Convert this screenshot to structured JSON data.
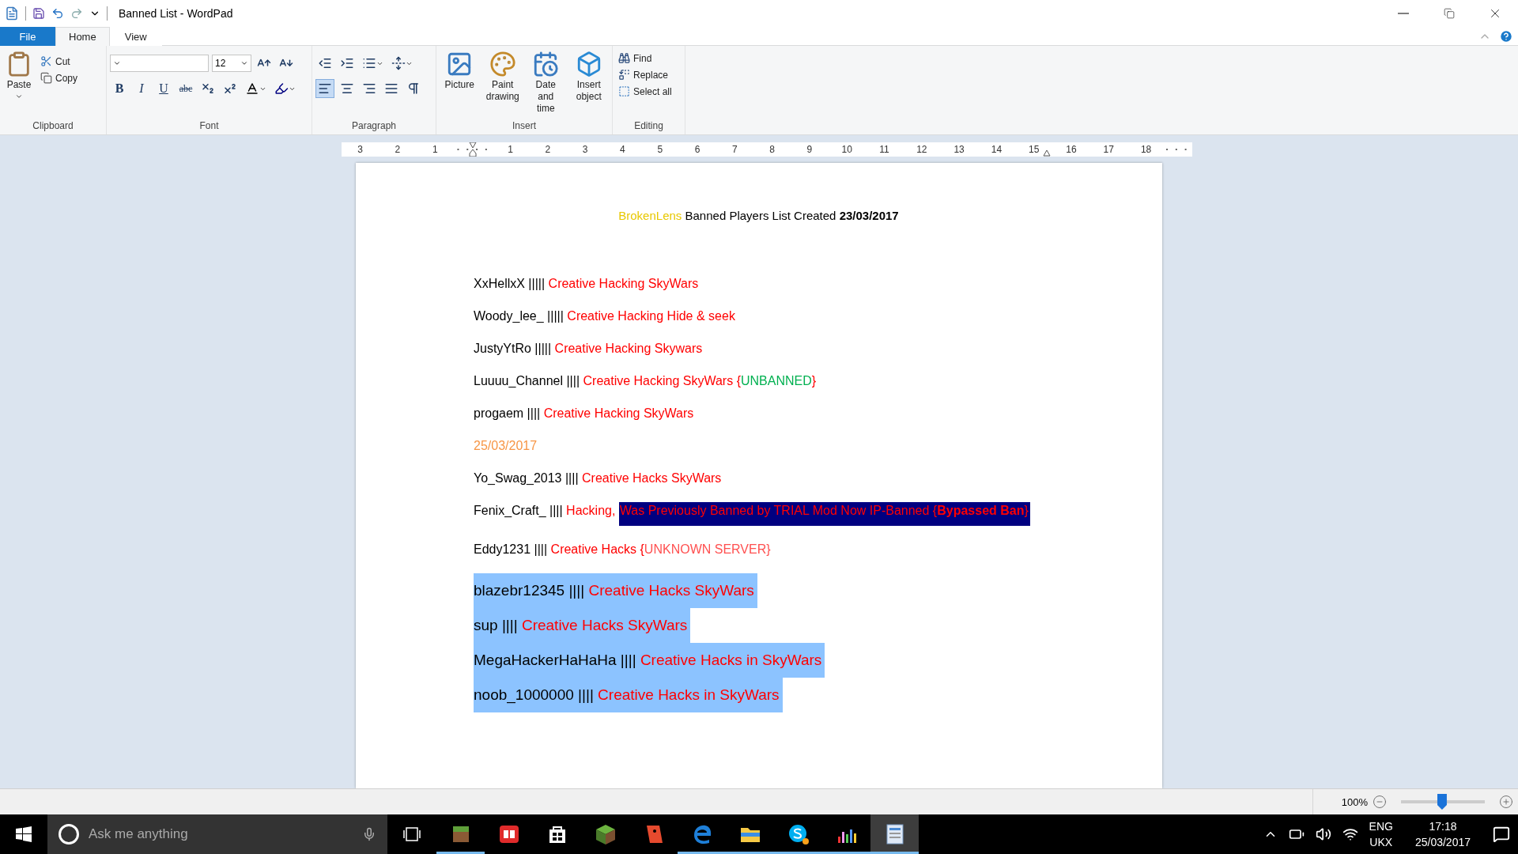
{
  "window": {
    "title": "Banned List - WordPad"
  },
  "tabs": [
    {
      "label": "File",
      "kind": "file",
      "selected": false
    },
    {
      "label": "Home",
      "kind": "tab",
      "selected": true
    },
    {
      "label": "View",
      "kind": "tab",
      "selected": false
    }
  ],
  "ribbon": {
    "clipboard": {
      "paste": "Paste",
      "cut": "Cut",
      "copy": "Copy",
      "label": "Clipboard"
    },
    "font": {
      "size": "12",
      "style_buttons": [
        {
          "label": "B",
          "kind": "bold"
        },
        {
          "label": "I",
          "kind": "italic"
        },
        {
          "label": "U",
          "kind": "underline"
        },
        {
          "label": "abc",
          "kind": "strike"
        }
      ],
      "label": "Font"
    },
    "paragraph": {
      "alignment": [
        {
          "selected": true
        },
        {
          "selected": false
        },
        {
          "selected": false
        },
        {
          "selected": false
        }
      ],
      "label": "Paragraph"
    },
    "insert": {
      "buttons": [
        {
          "label": "Picture",
          "kind": "picture"
        },
        {
          "label": "Paint drawing",
          "kind": "paint"
        },
        {
          "label": "Date and time",
          "kind": "date"
        },
        {
          "label": "Insert object",
          "kind": "object"
        }
      ],
      "label": "Insert"
    },
    "editing": {
      "buttons": [
        {
          "label": "Find",
          "kind": "find"
        },
        {
          "label": "Replace",
          "kind": "replace"
        },
        {
          "label": "Select all",
          "kind": "select"
        }
      ],
      "label": "Editing"
    }
  },
  "ruler": {
    "left_numbers": [
      "3",
      "2",
      "1"
    ],
    "right_numbers": [
      "1",
      "2",
      "3",
      "4",
      "5",
      "6",
      "7",
      "8",
      "9",
      "10",
      "11",
      "12",
      "13",
      "14",
      "15",
      "16",
      "17",
      "18"
    ]
  },
  "document": {
    "lines": [
      {
        "kind": "title",
        "selected": false,
        "segments": [
          {
            "text": "BrokenLens",
            "color": "#e8c800",
            "highlighted": false
          },
          {
            "text": " Banned Players List Created **23/03/2017**",
            "color": "#000000",
            "highlighted": false
          }
        ]
      },
      {
        "kind": "body",
        "selected": false,
        "segments": [
          {
            "text": "XxHellxX |||||",
            "color": "#000000",
            "highlighted": false
          },
          {
            "text": " Creative Hacking SkyWars",
            "color": "#ff0000",
            "highlighted": false
          }
        ]
      },
      {
        "kind": "body",
        "selected": false,
        "segments": [
          {
            "text": "Woody_lee_ |||||",
            "color": "#000000",
            "highlighted": false
          },
          {
            "text": " Creative Hacking Hide & seek",
            "color": "#ff0000",
            "highlighted": false
          }
        ]
      },
      {
        "kind": "body",
        "selected": false,
        "segments": [
          {
            "text": "JustyYtRo |||||",
            "color": "#000000",
            "highlighted": false
          },
          {
            "text": " Creative Hacking Skywars",
            "color": "#ff0000",
            "highlighted": false
          }
        ]
      },
      {
        "kind": "body",
        "selected": false,
        "segments": [
          {
            "text": "Luuuu_Channel ||||",
            "color": "#000000",
            "highlighted": false
          },
          {
            "text": " Creative Hacking SkyWars {",
            "color": "#ff0000",
            "highlighted": false
          },
          {
            "text": "UNBANNED",
            "color": "#00b050",
            "highlighted": false
          },
          {
            "text": "}",
            "color": "#ff0000",
            "highlighted": false
          }
        ]
      },
      {
        "kind": "body",
        "selected": false,
        "segments": [
          {
            "text": "progaem ||||",
            "color": "#000000",
            "highlighted": false
          },
          {
            "text": " Creative Hacking SkyWars",
            "color": "#ff0000",
            "highlighted": false
          }
        ]
      },
      {
        "kind": "body",
        "selected": false,
        "segments": [
          {
            "text": "25/03/2017",
            "color": "#f79646",
            "highlighted": false
          }
        ]
      },
      {
        "kind": "body",
        "selected": false,
        "segments": [
          {
            "text": "Yo_Swag_2013 ||||",
            "color": "#000000",
            "highlighted": false
          },
          {
            "text": " Creative Hacks SkyWars",
            "color": "#ff0000",
            "highlighted": false
          }
        ]
      },
      {
        "kind": "body",
        "selected": false,
        "segments": [
          {
            "text": "Fenix_Craft_ ||||",
            "color": "#000000",
            "highlighted": false
          },
          {
            "text": " Hacking, ",
            "color": "#ff0000",
            "highlighted": false
          },
          {
            "text": "Was Previously Banned by TRIAL Mod Now IP-Banned {**Bypassed Ban**}",
            "color": "#ff0000",
            "highlighted": true
          }
        ]
      },
      {
        "kind": "body",
        "selected": false,
        "segments": [
          {
            "text": "Eddy1231 ||||",
            "color": "#000000",
            "highlighted": false
          },
          {
            "text": " Creative Hacks {",
            "color": "#ff0000",
            "highlighted": false
          },
          {
            "text": "UNKNOWN SERVER}",
            "color": "#ff5050",
            "highlighted": false
          }
        ]
      },
      {
        "kind": "large",
        "selected": true,
        "segments": [
          {
            "text": "blazebr12345 ||||",
            "color": "#000000",
            "highlighted": false
          },
          {
            "text": " Creative Hacks SkyWars",
            "color": "#ff0000",
            "highlighted": false
          }
        ]
      },
      {
        "kind": "large",
        "selected": true,
        "segments": [
          {
            "text": "sup ||||",
            "color": "#000000",
            "highlighted": false
          },
          {
            "text": " Creative Hacks SkyWars",
            "color": "#ff0000",
            "highlighted": false
          }
        ]
      },
      {
        "kind": "large",
        "selected": true,
        "segments": [
          {
            "text": "MegaHackerHaHaHa ||||",
            "color": "#000000",
            "highlighted": false
          },
          {
            "text": " Creative Hacks in SkyWars",
            "color": "#ff0000",
            "highlighted": false
          }
        ]
      },
      {
        "kind": "large",
        "selected": true,
        "segments": [
          {
            "text": "noob_1000000 ||||",
            "color": "#000000",
            "highlighted": false
          },
          {
            "text": " Creative Hacks in SkyWars",
            "color": "#ff0000",
            "highlighted": false
          }
        ]
      }
    ]
  },
  "status_bar": {
    "zoom": "100%",
    "level": 0.49
  },
  "taskbar": {
    "search": {
      "placeholder": "Ask me anything"
    },
    "apps": [
      {
        "kind": "grass",
        "running": true,
        "selected": false
      },
      {
        "kind": "book",
        "running": false,
        "selected": false
      },
      {
        "kind": "store",
        "running": false,
        "selected": false
      },
      {
        "kind": "block",
        "running": false,
        "selected": false
      },
      {
        "kind": "figure",
        "running": false,
        "selected": false
      },
      {
        "kind": "edge",
        "running": true,
        "selected": false
      },
      {
        "kind": "folder",
        "running": true,
        "selected": false
      },
      {
        "kind": "skype",
        "running": true,
        "selected": false
      },
      {
        "kind": "bars",
        "running": true,
        "selected": false
      },
      {
        "kind": "wordpad",
        "running": true,
        "selected": true
      }
    ],
    "language": "ENG",
    "layout": "UKX",
    "time": "17:18",
    "date": "25/03/2017"
  }
}
